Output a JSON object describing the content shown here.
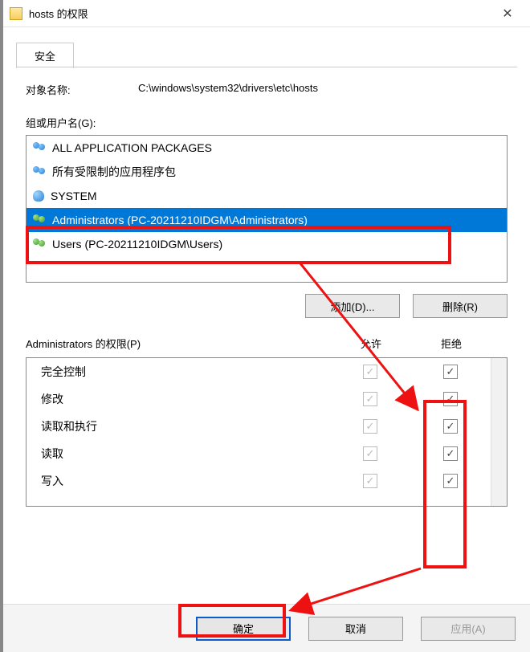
{
  "window": {
    "title": "hosts 的权限"
  },
  "tab": {
    "security": "安全"
  },
  "object": {
    "label": "对象名称:",
    "value": "C:\\windows\\system32\\drivers\\etc\\hosts"
  },
  "group": {
    "label": "组或用户名(G):",
    "items": [
      {
        "name": "ALL APPLICATION PACKAGES",
        "icon": "two-people blue"
      },
      {
        "name": "所有受限制的应用程序包",
        "icon": "two-people blue"
      },
      {
        "name": "SYSTEM",
        "icon": "one-person"
      },
      {
        "name": "Administrators (PC-20211210IDGM\\Administrators)",
        "icon": "two-people green",
        "selected": true
      },
      {
        "name": "Users (PC-20211210IDGM\\Users)",
        "icon": "two-people green"
      }
    ]
  },
  "buttons": {
    "add": "添加(D)...",
    "remove": "删除(R)",
    "ok": "确定",
    "cancel": "取消",
    "apply": "应用(A)"
  },
  "permissions": {
    "header_label": "Administrators 的权限(P)",
    "col_allow": "允许",
    "col_deny": "拒绝",
    "rows": [
      {
        "name": "完全控制",
        "allow": true,
        "deny": true
      },
      {
        "name": "修改",
        "allow": true,
        "deny": true
      },
      {
        "name": "读取和执行",
        "allow": true,
        "deny": true
      },
      {
        "name": "读取",
        "allow": true,
        "deny": true
      },
      {
        "name": "写入",
        "allow": true,
        "deny": true
      }
    ]
  }
}
